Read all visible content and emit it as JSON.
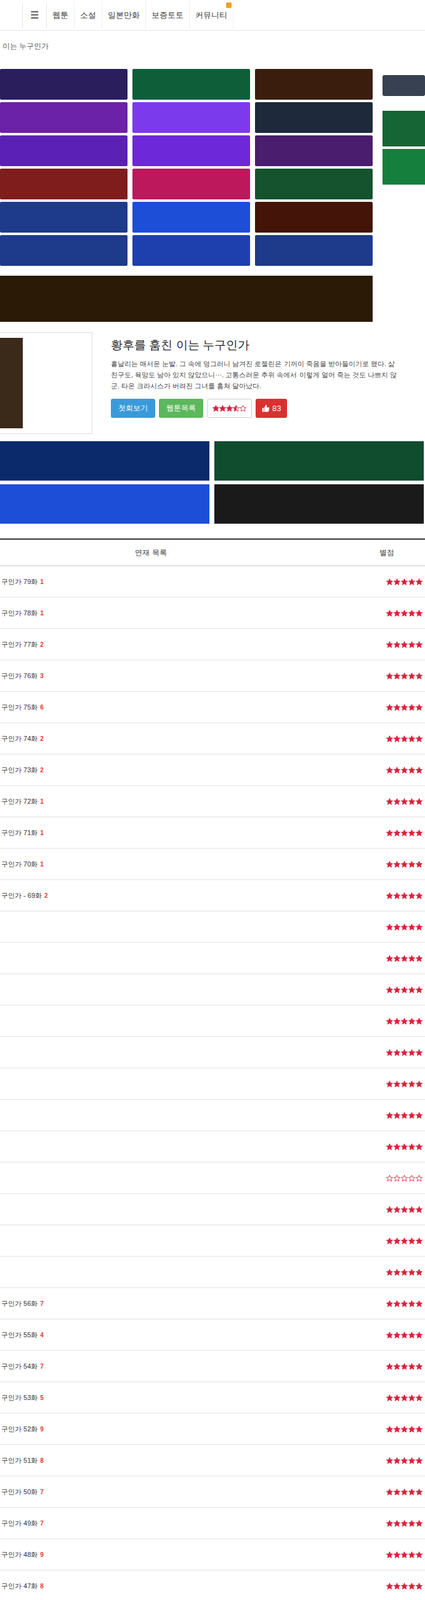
{
  "nav": {
    "menu_icon": "☰",
    "items": [
      {
        "label": "웹툰",
        "badge": false
      },
      {
        "label": "소설",
        "badge": false
      },
      {
        "label": "일본만화",
        "badge": false
      },
      {
        "label": "보증토토",
        "badge": false
      },
      {
        "label": "커뮤니티",
        "badge": true
      }
    ]
  },
  "breadcrumb": "이는 누구인가",
  "banners": {
    "grid": [
      {
        "color": "#2a1f5c"
      },
      {
        "color": "#0f5e3a"
      },
      {
        "color": "#3b1d0e"
      },
      {
        "color": "#6b21a8"
      },
      {
        "color": "#7c3aed"
      },
      {
        "color": "#1e293b"
      },
      {
        "color": "#5b21b6"
      },
      {
        "color": "#6d28d9"
      },
      {
        "color": "#4a1d6e"
      },
      {
        "color": "#7f1d1d"
      },
      {
        "color": "#be185d"
      },
      {
        "color": "#14532d"
      },
      {
        "color": "#1e3a8a"
      },
      {
        "color": "#1d4ed8"
      },
      {
        "color": "#431407"
      },
      {
        "color": "#1e3a8a"
      },
      {
        "color": "#1e40af"
      },
      {
        "color": "#1e3a8a"
      }
    ],
    "side": [
      {
        "color": "#374151"
      },
      {
        "color": "#166534"
      },
      {
        "color": "#15803d"
      }
    ]
  },
  "hero_banner": {
    "color": "#2b1a05"
  },
  "webtoon": {
    "title": "황후를 훔친 이는 누구인가",
    "description": [
      "흩날리는 매서운 눈발. 그 속에 덩그러니 남겨진 로젤린은 기꺼이 죽음을 받아들이기로 했다. 삶",
      "친구도, 육망도 남아 있지 않았으니···. 고통스러운 추위 속에서 이렇게 얼어 죽는 것도 나쁘지 않",
      "군. 타온 크라시스가 버려진 그녀를 훔쳐 달아났다."
    ],
    "buttons": [
      {
        "label": "첫회보기",
        "color": "#3a9ad9"
      },
      {
        "label": "웹툰목록",
        "color": "#5cb85c"
      }
    ],
    "rating": {
      "stars": 3.5
    },
    "likes": "83"
  },
  "promo_banners": [
    {
      "color": "#0b2a6b"
    },
    {
      "color": "#0f4d2e"
    },
    {
      "color": "#1d4ed8"
    },
    {
      "color": "#1a1a1a"
    }
  ],
  "table": {
    "columns": [
      "연재 목록",
      "별점"
    ],
    "rows": [
      {
        "title": "구인가 79화",
        "count": "1",
        "stars": 5
      },
      {
        "title": "구인가 78화",
        "count": "1",
        "stars": 5
      },
      {
        "title": "구인가 77화",
        "count": "2",
        "stars": 5
      },
      {
        "title": "구인가 76화",
        "count": "3",
        "stars": 5
      },
      {
        "title": "구인가 75화",
        "count": "6",
        "stars": 5
      },
      {
        "title": "구인가 74화",
        "count": "2",
        "stars": 5
      },
      {
        "title": "구인가 73화",
        "count": "2",
        "stars": 5
      },
      {
        "title": "구인가 72화",
        "count": "1",
        "stars": 5
      },
      {
        "title": "구인가 71화",
        "count": "1",
        "stars": 5
      },
      {
        "title": "구인가 70화",
        "count": "1",
        "stars": 5
      },
      {
        "title": "구인가 - 69화",
        "count": "2",
        "stars": 5
      },
      {
        "title": "",
        "count": "",
        "stars": 5
      },
      {
        "title": "",
        "count": "",
        "stars": 5
      },
      {
        "title": "",
        "count": "",
        "stars": 5
      },
      {
        "title": "",
        "count": "",
        "stars": 5
      },
      {
        "title": "",
        "count": "",
        "stars": 5
      },
      {
        "title": "",
        "count": "",
        "stars": 5
      },
      {
        "title": "",
        "count": "",
        "stars": 5
      },
      {
        "title": "",
        "count": "",
        "stars": 5
      },
      {
        "title": "",
        "count": "",
        "stars": 0
      },
      {
        "title": "",
        "count": "",
        "stars": 5
      },
      {
        "title": "",
        "count": "",
        "stars": 5
      },
      {
        "title": "",
        "count": "",
        "stars": 5
      },
      {
        "title": "구인가 56화",
        "count": "7",
        "stars": 5
      },
      {
        "title": "구인가 55화",
        "count": "4",
        "stars": 5
      },
      {
        "title": "구인가 54화",
        "count": "7",
        "stars": 5
      },
      {
        "title": "구인가 53화",
        "count": "5",
        "stars": 5
      },
      {
        "title": "구인가 52화",
        "count": "9",
        "stars": 5
      },
      {
        "title": "구인가 51화",
        "count": "8",
        "stars": 5
      },
      {
        "title": "구인가 50화",
        "count": "7",
        "stars": 5
      },
      {
        "title": "구인가 49화",
        "count": "7",
        "stars": 5
      },
      {
        "title": "구인가 48화",
        "count": "9",
        "stars": 5
      },
      {
        "title": "구인가 47화",
        "count": "8",
        "stars": 5
      }
    ]
  }
}
